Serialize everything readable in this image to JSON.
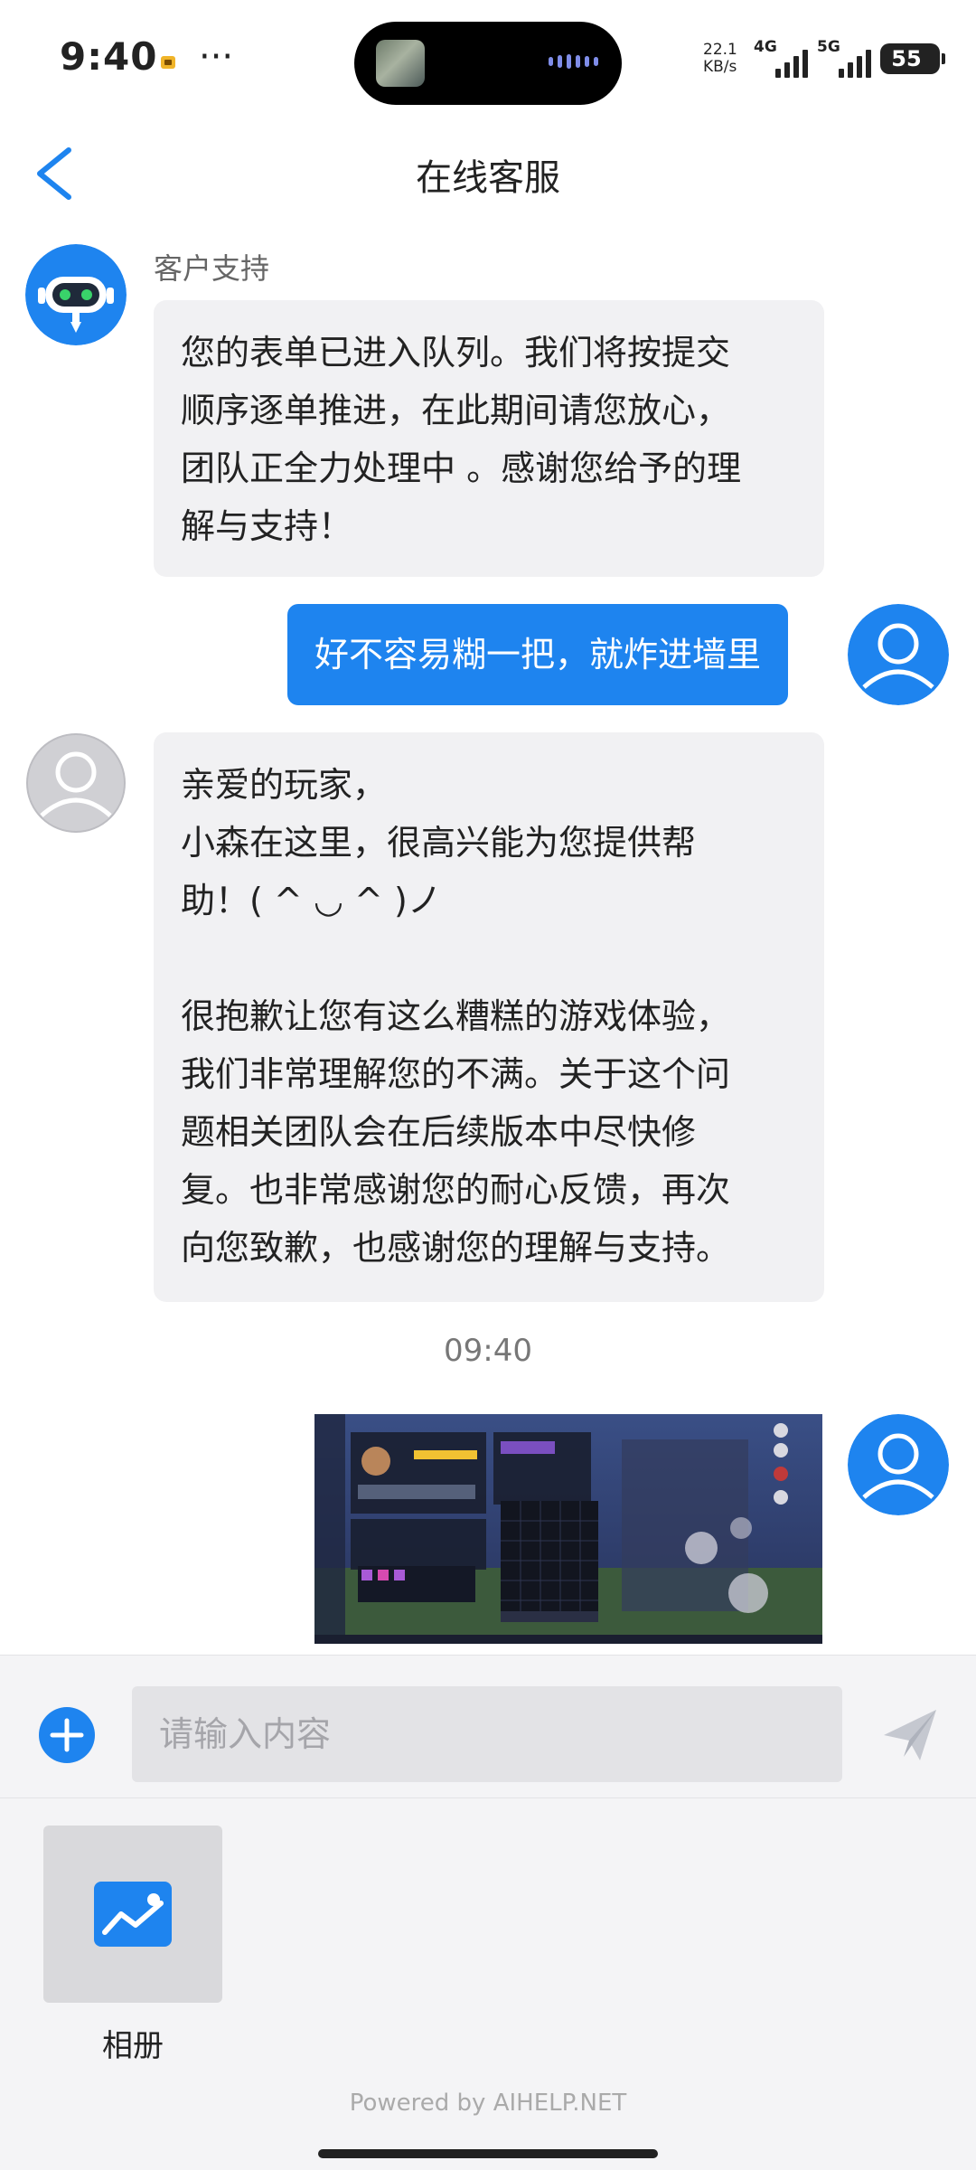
{
  "status_bar": {
    "time": "9:40",
    "dots": "···",
    "speed_value": "22.1",
    "speed_unit": "KB/s",
    "net1": "4G",
    "net2": "5G",
    "battery": "55"
  },
  "header": {
    "title": "在线客服",
    "back_icon": "chevron-left-icon"
  },
  "messages": [
    {
      "sender": "客户支持",
      "side": "incoming",
      "text": "您的表单已进入队列。我们将按提交\n顺序逐单推进，在此期间请您放心，\n团队正全力处理中 。感谢您给予的理\n解与支持！"
    },
    {
      "side": "outgoing",
      "text": "好不容易糊一把，就炸进墙里"
    },
    {
      "side": "incoming",
      "text": "亲爱的玩家，\n小森在这里，很高兴能为您提供帮\n助！( ^ ◡ ^ )ノ\n\n很抱歉让您有这么糟糕的游戏体验，\n我们非常理解您的不满。关于这个问\n题相关团队会在后续版本中尽快修\n复。也非常感谢您的耐心反馈，再次\n向您致歉，也感谢您的理解与支持。"
    }
  ],
  "timestamp": "09:40",
  "input": {
    "placeholder": "请输入内容",
    "value": ""
  },
  "attachments": {
    "album_label": "相册"
  },
  "footer": {
    "powered_by": "Powered by AIHELP.NET"
  },
  "colors": {
    "accent": "#1E84EF",
    "bubble_incoming": "#F1F1F3",
    "panel_bg": "#F4F4F6"
  }
}
